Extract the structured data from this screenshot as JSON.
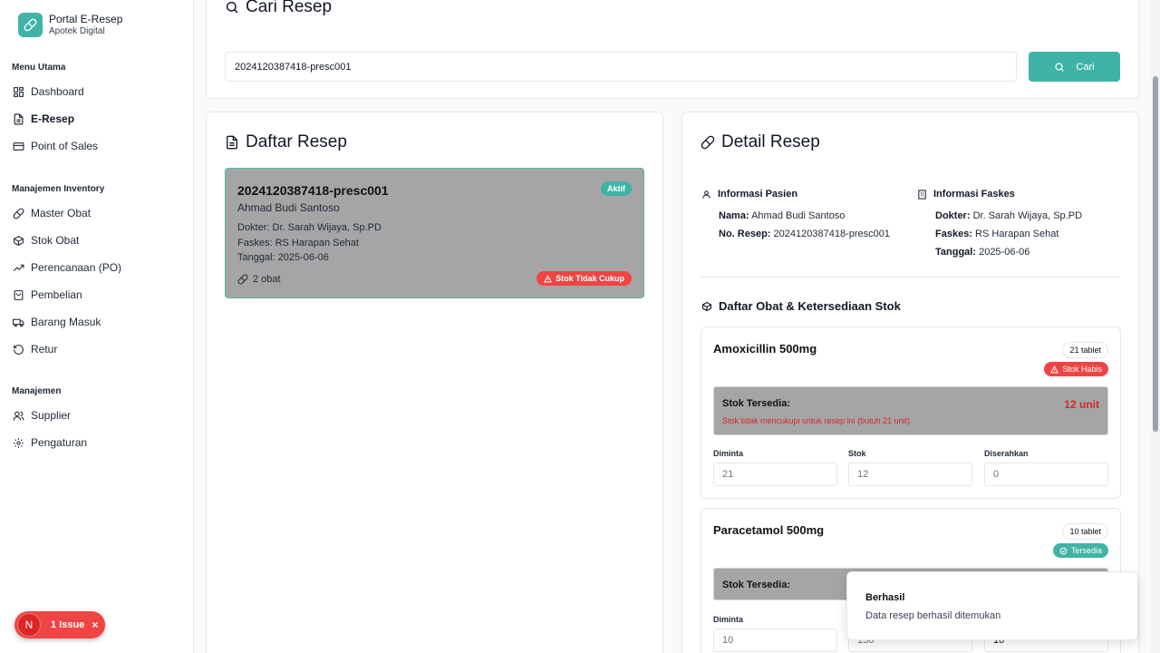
{
  "brand": {
    "title": "Portal E-Resep",
    "subtitle": "Apotek Digital"
  },
  "sidebar": {
    "sections": [
      {
        "label": "Menu Utama",
        "items": [
          {
            "label": "Dashboard",
            "icon": "dashboard-icon"
          },
          {
            "label": "E-Resep",
            "icon": "file-icon",
            "active": true
          },
          {
            "label": "Point of Sales",
            "icon": "card-icon"
          }
        ]
      },
      {
        "label": "Manajemen Inventory",
        "items": [
          {
            "label": "Master Obat",
            "icon": "pill-icon"
          },
          {
            "label": "Stok Obat",
            "icon": "box-icon"
          },
          {
            "label": "Perencanaan (PO)",
            "icon": "trend-icon"
          },
          {
            "label": "Pembelian",
            "icon": "cart-icon"
          },
          {
            "label": "Barang Masuk",
            "icon": "truck-icon"
          },
          {
            "label": "Retur",
            "icon": "return-icon"
          }
        ]
      },
      {
        "label": "Manajemen",
        "items": [
          {
            "label": "Supplier",
            "icon": "users-icon"
          },
          {
            "label": "Pengaturan",
            "icon": "gear-icon"
          }
        ]
      }
    ]
  },
  "search": {
    "title": "Cari Resep",
    "value": "2024120387418-presc001",
    "button": "Cari"
  },
  "list": {
    "title": "Daftar Resep",
    "item": {
      "id": "2024120387418-presc001",
      "patient": "Ahmad Budi Santoso",
      "doctor": "Dokter: Dr. Sarah Wijaya, Sp.PD",
      "faskes": "Faskes: RS Harapan Sehat",
      "date": "Tanggal: 2025-06-06",
      "count": "2 obat",
      "status": "Aktif",
      "warning": "Stok Tidak Cukup"
    }
  },
  "detail": {
    "title": "Detail Resep",
    "patient_heading": "Informasi Pasien",
    "patient_name_label": "Nama:",
    "patient_name": "Ahmad Budi Santoso",
    "rx_label": "No. Resep:",
    "rx_no": "2024120387418-presc001",
    "faskes_heading": "Informasi Faskes",
    "doctor_label": "Dokter:",
    "doctor": "Dr. Sarah Wijaya, Sp.PD",
    "faskes_label": "Faskes:",
    "faskes": "RS Harapan Sehat",
    "date_label": "Tanggal:",
    "date": "2025-06-06",
    "meds_heading": "Daftar Obat & Ketersediaan Stok",
    "meds": [
      {
        "name": "Amoxicillin 500mg",
        "qty": "21 tablet",
        "status": "Stok Habis",
        "stock_label": "Stok Tersedia:",
        "stock_value": "12 unit",
        "warning": "Stok tidak mencukupi untuk resep ini (butuh 21 unit)",
        "requested_label": "Diminta",
        "requested": "21",
        "stock_field_label": "Stok",
        "stock": "12",
        "given_label": "Diserahkan",
        "given": "0"
      },
      {
        "name": "Paracetamol 500mg",
        "qty": "10 tablet",
        "status": "Tersedia",
        "stock_label": "Stok Tersedia:",
        "requested_label": "Diminta",
        "requested": "10",
        "stock": "150",
        "given": "10"
      }
    ]
  },
  "issue": {
    "letter": "N",
    "label": "1 Issue",
    "close": "×"
  },
  "toast": {
    "title": "Berhasil",
    "message": "Data resep berhasil ditemukan"
  },
  "colors": {
    "accent": "#3fb4a6",
    "danger": "#ef4444"
  }
}
